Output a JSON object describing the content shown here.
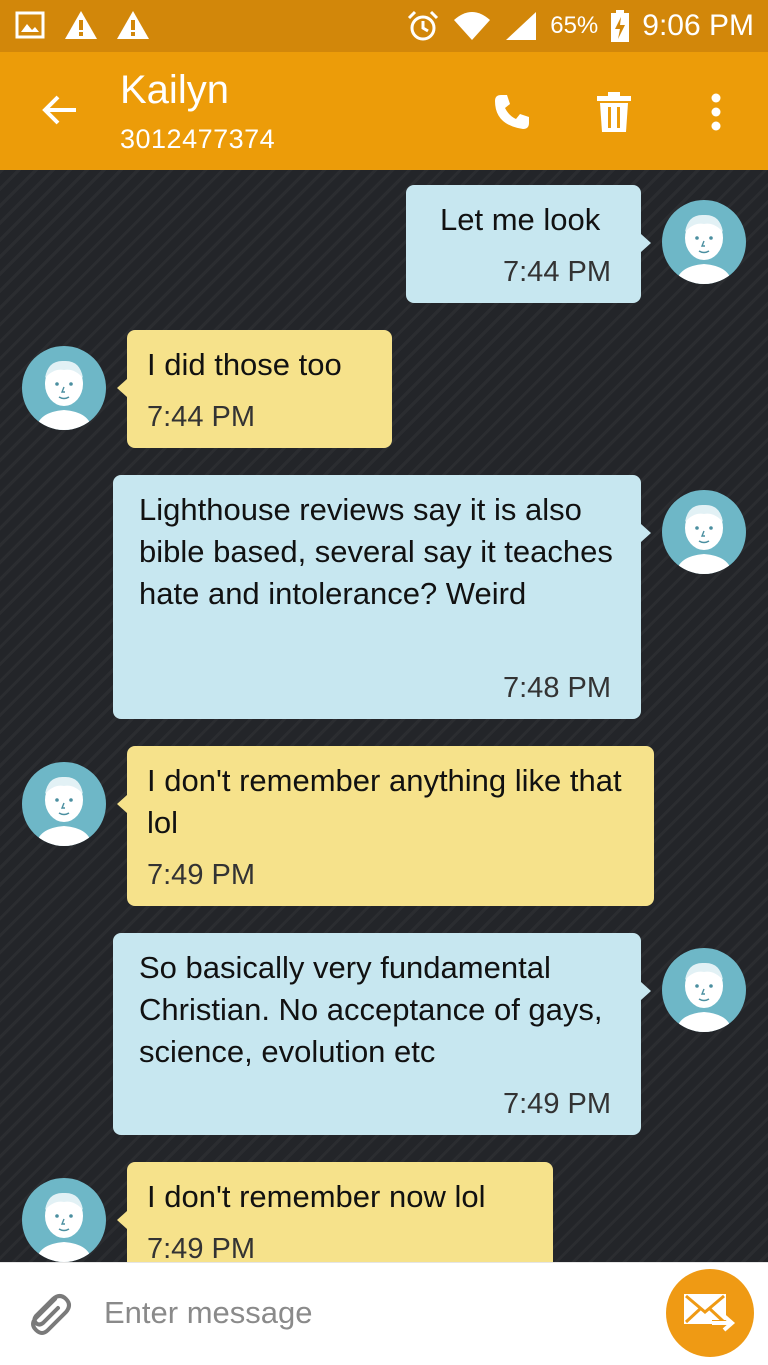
{
  "status_bar": {
    "battery_percent": "65%",
    "time": "9:06 PM",
    "icons": [
      "image-icon",
      "warning-icon",
      "warning-icon",
      "alarm-icon",
      "wifi-icon",
      "signal-icon",
      "battery-charging-icon"
    ]
  },
  "header": {
    "contact_name": "Kailyn",
    "contact_number": "3012477374",
    "icons": [
      "back-arrow-icon",
      "phone-icon",
      "trash-icon",
      "more-vert-icon"
    ]
  },
  "messages": [
    {
      "direction": "outgoing",
      "text": "Let me look",
      "time": "7:44 PM"
    },
    {
      "direction": "incoming",
      "text": "I did those too",
      "time": "7:44 PM"
    },
    {
      "direction": "outgoing",
      "text": "Lighthouse reviews say it is also bible based, several say it teaches hate and intolerance? Weird",
      "time": "7:48 PM"
    },
    {
      "direction": "incoming",
      "text": "I don't remember anything like that lol",
      "time": "7:49 PM"
    },
    {
      "direction": "outgoing",
      "text": "So basically very fundamental Christian. No acceptance of gays, science, evolution etc",
      "time": "7:49 PM"
    },
    {
      "direction": "incoming",
      "text": "I don't remember now lol",
      "time": "7:49 PM"
    }
  ],
  "composer": {
    "placeholder": "Enter message",
    "icons": [
      "paperclip-icon",
      "send-message-icon"
    ]
  },
  "colors": {
    "status_bar": "#d2870a",
    "app_bar": "#ec9c09",
    "outgoing_bubble": "#c7e7f0",
    "incoming_bubble": "#f6e28b",
    "avatar": "#6eb7c7",
    "send_button": "#ef9a14"
  }
}
